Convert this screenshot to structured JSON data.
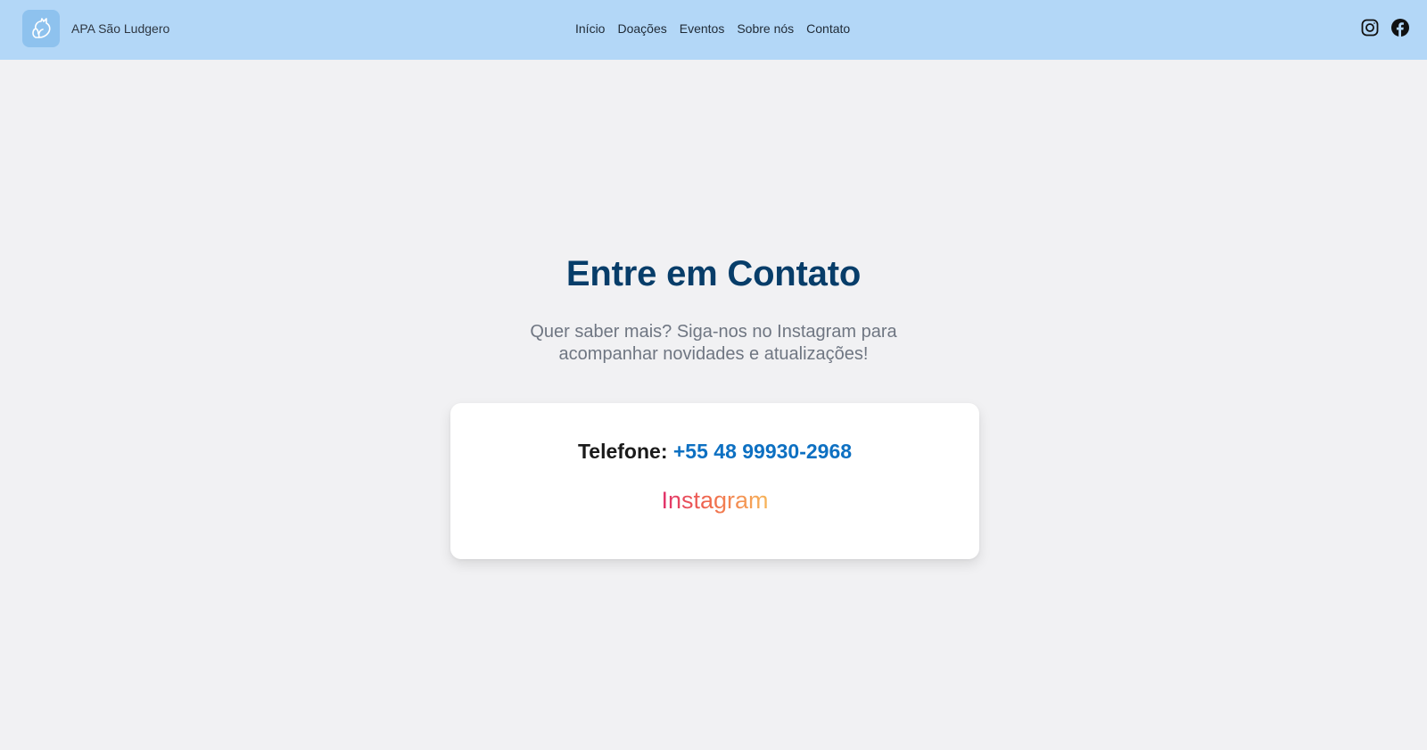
{
  "header": {
    "brand_name": "APA São Ludgero",
    "logo_icon": "cat-dog-silhouette-icon",
    "nav": [
      {
        "label": "Início"
      },
      {
        "label": "Doações"
      },
      {
        "label": "Eventos"
      },
      {
        "label": "Sobre nós"
      },
      {
        "label": "Contato"
      }
    ],
    "social_icons": [
      "instagram-icon",
      "facebook-icon"
    ],
    "background_color": "#b3d7f7"
  },
  "main": {
    "title": "Entre em Contato",
    "subtitle": "Quer saber mais? Siga-nos no Instagram para acompanhar novidades e atualizações!",
    "card": {
      "phone_label": "Telefone:",
      "phone_number": "+55 48 99930-2968",
      "instagram_label": "Instagram"
    }
  },
  "colors": {
    "title": "#073d69",
    "link": "#0d70c2",
    "page_background": "#f1f1f3"
  }
}
